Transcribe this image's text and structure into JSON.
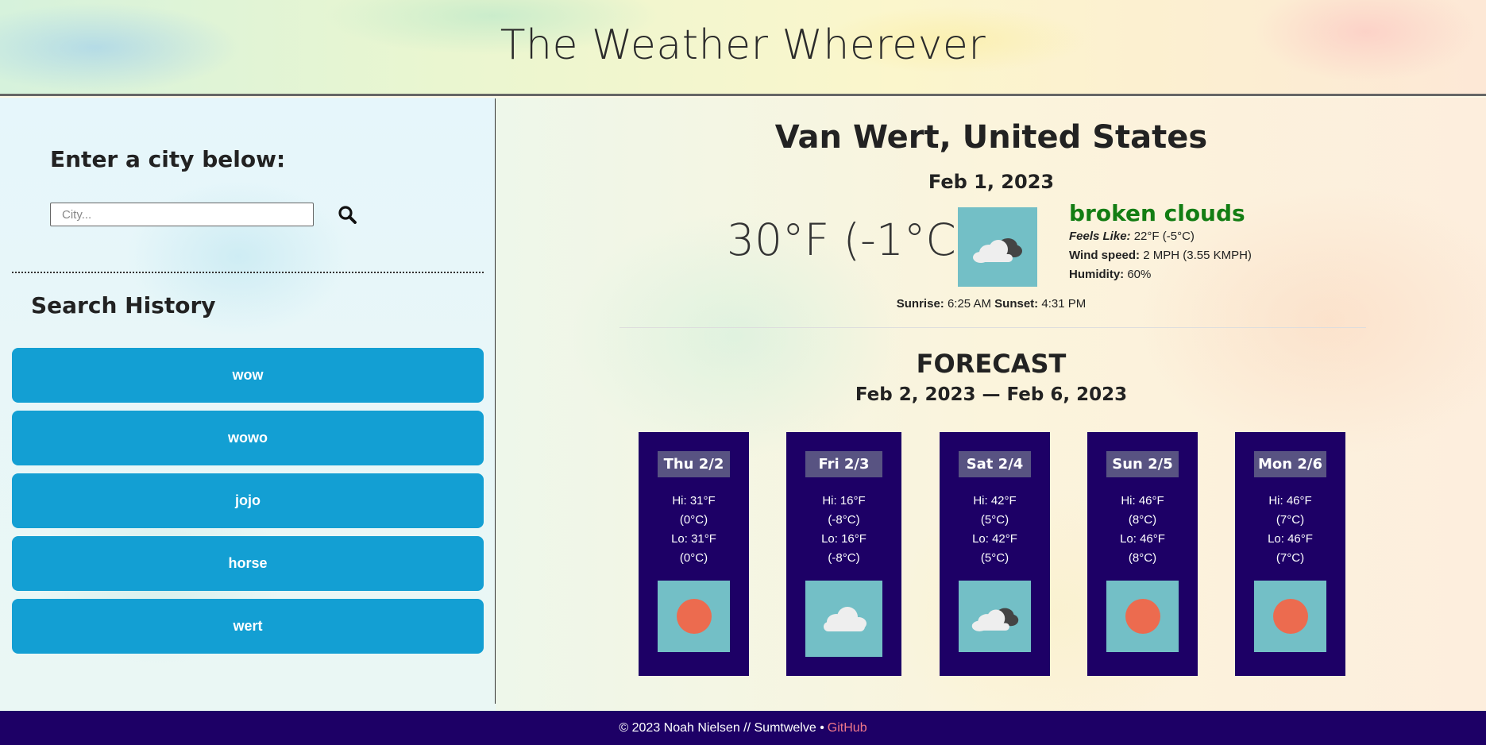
{
  "header": {
    "title": "The Weather Wherever"
  },
  "sidebar": {
    "prompt": "Enter a city below:",
    "search": {
      "placeholder": "City...",
      "icon": "search-icon"
    },
    "history_title": "Search History",
    "history": [
      "wow",
      "wowo",
      "jojo",
      "horse",
      "wert"
    ]
  },
  "current": {
    "city": "Van Wert, United States",
    "date": "Feb 1, 2023",
    "temp": "30°F (-1°C)",
    "icon": "broken-clouds-icon",
    "description": "broken clouds",
    "feels_like_label": "Feels Like:",
    "feels_like": "22°F (-5°C)",
    "wind_label": "Wind speed:",
    "wind": "2 MPH (3.55 KMPH)",
    "humidity_label": "Humidity:",
    "humidity": "60%",
    "sunrise_label": "Sunrise:",
    "sunrise": "6:25 AM",
    "sunset_label": "Sunset:",
    "sunset": "4:31 PM"
  },
  "forecast": {
    "title": "FORECAST",
    "range": "Feb 2, 2023 — Feb 6, 2023",
    "days": [
      {
        "day": "Thu 2/2",
        "hi": "Hi: 31°F",
        "hi_c": "(0°C)",
        "lo": "Lo: 31°F",
        "lo_c": "(0°C)",
        "icon": "clear-sun-icon"
      },
      {
        "day": "Fri 2/3",
        "hi": "Hi: 16°F",
        "hi_c": "(-8°C)",
        "lo": "Lo: 16°F",
        "lo_c": "(-8°C)",
        "icon": "cloud-icon"
      },
      {
        "day": "Sat 2/4",
        "hi": "Hi: 42°F",
        "hi_c": "(5°C)",
        "lo": "Lo: 42°F",
        "lo_c": "(5°C)",
        "icon": "broken-clouds-icon"
      },
      {
        "day": "Sun 2/5",
        "hi": "Hi: 46°F",
        "hi_c": "(8°C)",
        "lo": "Lo: 46°F",
        "lo_c": "(8°C)",
        "icon": "clear-sun-icon"
      },
      {
        "day": "Mon 2/6",
        "hi": "Hi: 46°F",
        "hi_c": "(7°C)",
        "lo": "Lo: 46°F",
        "lo_c": "(7°C)",
        "icon": "clear-sun-icon"
      }
    ]
  },
  "footer": {
    "text": "© 2023 Noah Nielsen // Sumtwelve •",
    "link": "GitHub"
  },
  "colors": {
    "history_button": "#139fd3",
    "card_bg": "#1d0066",
    "description": "#137d13",
    "icon_bg": "#73bfc6",
    "link": "#f0788a"
  }
}
